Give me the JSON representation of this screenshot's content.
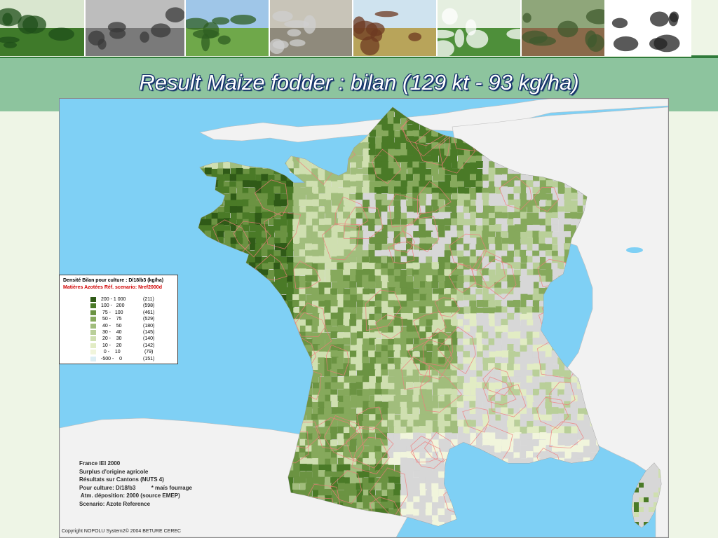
{
  "photos": [
    {
      "name": "photo-tractor-field",
      "sky": "#d9e6cf",
      "ground": "#3f7a2a",
      "accent": "#1f4f1a",
      "w": 120
    },
    {
      "name": "photo-aerial-village",
      "sky": "#bdbdbd",
      "ground": "#7a7a7a",
      "accent": "#3a3a3a",
      "w": 141
    },
    {
      "name": "photo-cattle-meadow",
      "sky": "#9fc6e8",
      "ground": "#6fa84a",
      "accent": "#2e5e22",
      "w": 118
    },
    {
      "name": "photo-dairy-equipment",
      "sky": "#c8c4b8",
      "ground": "#8f8a7c",
      "accent": "#cfcfcf",
      "w": 118
    },
    {
      "name": "photo-cows-orchard",
      "sky": "#cfe3ef",
      "ground": "#b8a45a",
      "accent": "#6e3a22",
      "w": 118
    },
    {
      "name": "photo-blossom-orchard",
      "sky": "#e5efe0",
      "ground": "#4e8f3a",
      "accent": "#ffffff",
      "w": 118
    },
    {
      "name": "photo-heathland",
      "sky": "#8fa67a",
      "ground": "#8a6a4a",
      "accent": "#3f5a2e",
      "w": 118
    },
    {
      "name": "photo-tree-drawing",
      "sky": "#ffffff",
      "ground": "#ffffff",
      "accent": "#222222",
      "w": 120
    }
  ],
  "title": "Result Maize fodder : bilan (129 kt - 93 kg/ha)",
  "legend": {
    "title": "Densité Bilan pour culture : D/18/b3  (kg/ha)",
    "subtitle": "Matières Azotées  Réf. scenario: Nref2000d",
    "classes": [
      {
        "range": "200 - 1 000",
        "count": "(211)",
        "color": "#2f5a17"
      },
      {
        "range": "100 -   200",
        "count": "(598)",
        "color": "#4a7a27"
      },
      {
        "range": " 75 -   100",
        "count": "(461)",
        "color": "#6b9342"
      },
      {
        "range": " 50 -    75",
        "count": "(529)",
        "color": "#86a95c"
      },
      {
        "range": " 40 -    50",
        "count": "(180)",
        "color": "#a1bd7c"
      },
      {
        "range": " 30 -    40",
        "count": "(145)",
        "color": "#b9cf99"
      },
      {
        "range": " 20 -    30",
        "count": "(140)",
        "color": "#cfdfb0"
      },
      {
        "range": " 10 -    20",
        "count": "(142)",
        "color": "#e2ecc4"
      },
      {
        "range": "  0 -    10",
        "count": " (79)",
        "color": "#f1f5dc"
      },
      {
        "range": "-500 -    0",
        "count": "(151)",
        "color": "#dbeef4"
      }
    ]
  },
  "info": {
    "lines": [
      "France IEI 2000",
      "Surplus d'origine agricole",
      "Résultats sur Cantons (NUTS 4)",
      "Pour culture: D/18/b3          * maïs fourrage",
      " Atm. déposition: 2000 (source EMEP)",
      "Scenario: Azote Reference"
    ]
  },
  "copyright": "Copyright NOPOLU System2© 2004 BETURE CEREC",
  "colors": {
    "sea": "#7fd0f5",
    "land_neighbor": "#f2f2f2",
    "land_low": "#d7d7d7",
    "boundary": "#f07a7a",
    "title_band": "#8dc49e"
  }
}
